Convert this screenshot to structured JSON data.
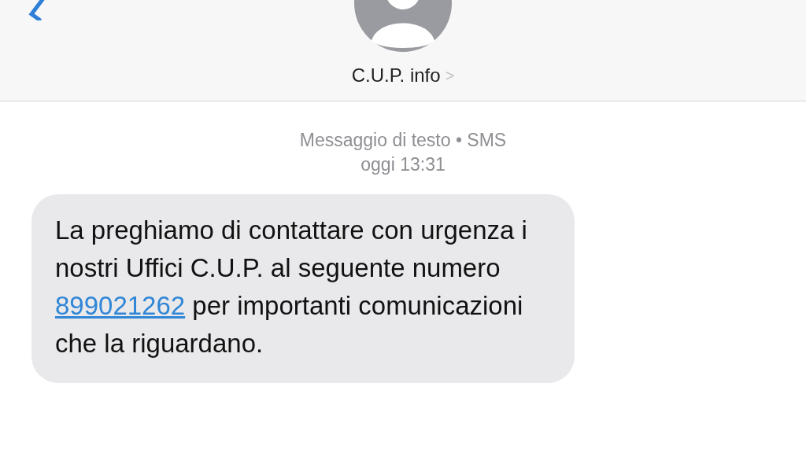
{
  "header": {
    "contact_name": "C.U.P. info",
    "chevron": ">"
  },
  "conversation": {
    "service": "Messaggio di testo • SMS",
    "time": "oggi 13:31",
    "messages": [
      {
        "kind": "incoming",
        "text_before": "La preghiamo di contattare con urgenza i nostri Uffici C.U.P. al seguente numero ",
        "link": "899021262",
        "text_after": " per importanti comunicazioni che la riguardano."
      }
    ]
  }
}
